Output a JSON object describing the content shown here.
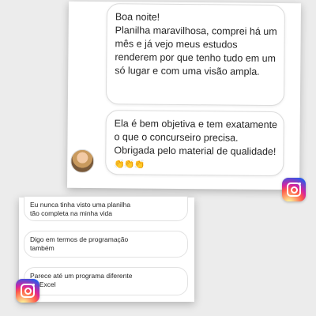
{
  "top_chat": {
    "message1": "Boa noite!\nPlanilha maravilhosa, comprei há um mês e já vejo meus estudos renderem por que tenho tudo em um só lugar e com uma visão ampla.",
    "message2": "Ela é bem objetiva e tem exatamente o que o concurseiro precisa. Obrigada pelo material de qualidade!",
    "message2_emoji": "👏👏👏"
  },
  "bottom_chat": {
    "message1": "Eu nunca tinha visto uma planilha\ntão completa na minha vida",
    "message2": "Digo em termos de programação\ntambém",
    "message3": "Parece até um programa diferente\ndo Excel"
  },
  "icons": {
    "top": "instagram-icon",
    "bottom": "instagram-icon"
  },
  "colors": {
    "text": "#262626",
    "bubble_border": "#dcdcdc"
  }
}
